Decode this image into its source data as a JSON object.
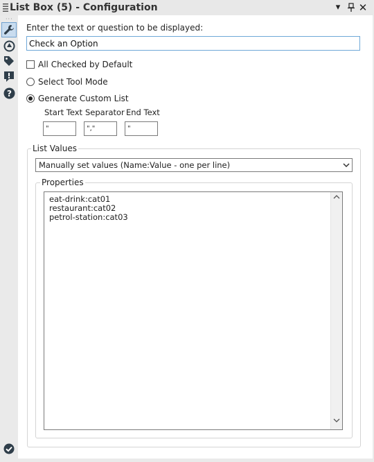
{
  "window": {
    "title": "List Box (5) - Configuration",
    "buttons": [
      "chevron-down",
      "pin",
      "close"
    ]
  },
  "rail": {
    "items": [
      {
        "icon": "wrench-icon"
      },
      {
        "icon": "target-icon"
      },
      {
        "icon": "tag-icon"
      },
      {
        "icon": "comment-alert-icon"
      },
      {
        "icon": "help-icon"
      },
      {
        "icon": "check-circle-icon"
      }
    ]
  },
  "form": {
    "prompt_label": "Enter the text or question to be displayed:",
    "prompt_value": "Check an Option",
    "all_checked_label": "All Checked by Default",
    "all_checked": false,
    "select_tool_label": "Select Tool Mode",
    "generate_custom_label": "Generate Custom List",
    "selected_mode": "generate_custom",
    "start_text_label": "Start Text",
    "start_text_value": "\"",
    "separator_label": "Separator",
    "separator_value": "\",\"",
    "end_text_label": "End Text",
    "end_text_value": "\""
  },
  "list_values": {
    "legend": "List Values",
    "dropdown_value": "Manually set values (Name:Value - one per line)",
    "properties_legend": "Properties",
    "lines": [
      "eat-drink:cat01",
      "restaurant:cat02",
      "petrol-station:cat03"
    ]
  }
}
